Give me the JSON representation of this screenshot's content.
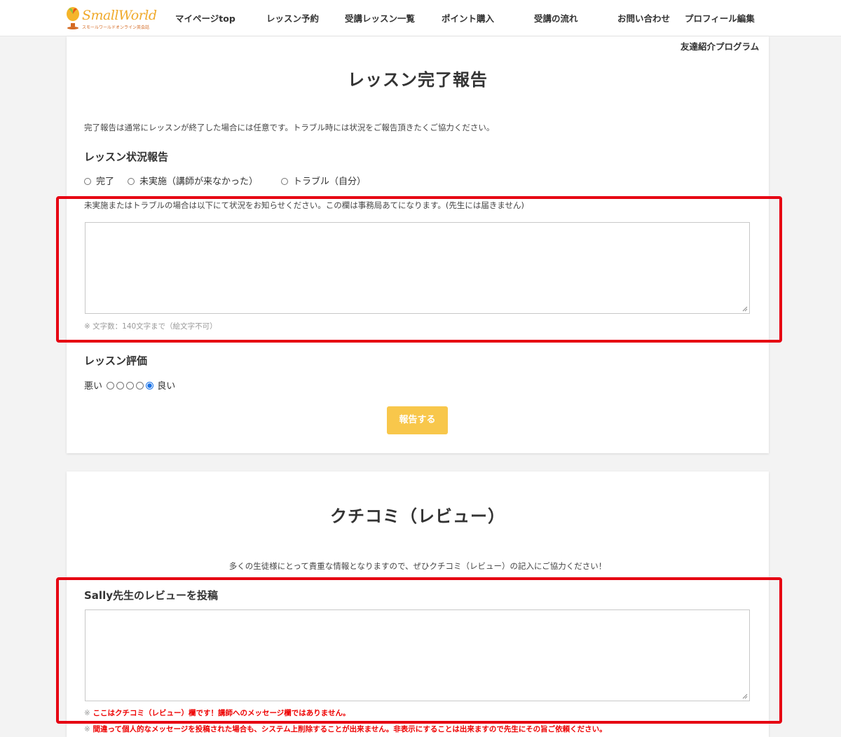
{
  "header": {
    "logo_text": "SmallWorld",
    "logo_sub": "スモールワールドオンライン英会話",
    "nav": [
      {
        "label": "マイページtop"
      },
      {
        "label": "レッスン予約"
      },
      {
        "label": "受講レッスン一覧"
      },
      {
        "label": "ポイント購入"
      },
      {
        "label": "受講の流れ"
      },
      {
        "label": "お問い合わせ"
      },
      {
        "label": "プロフィール編集"
      },
      {
        "label": "友達紹介プログラム"
      }
    ]
  },
  "report": {
    "title": "レッスン完了報告",
    "intro": "完了報告は通常にレッスンが終了した場合には任意です。トラブル時には状況をご報告頂きたくご協力ください。",
    "status_heading": "レッスン状況報告",
    "status_options": [
      {
        "label": "完了"
      },
      {
        "label": "未実施（講師が来なかった）"
      },
      {
        "label": "トラブル（自分）"
      }
    ],
    "note": "未実施またはトラブルの場合は以下にて状況をお知らせください。この欄は事務局あてになります。(先生には届きません)",
    "textarea_value": "",
    "hint": "※ 文字数：140文字まで（絵文字不可）",
    "rating_heading": "レッスン評価",
    "rating_bad": "悪い",
    "rating_good": "良い",
    "rating_count": 5,
    "rating_selected": 5,
    "submit_label": "報告する"
  },
  "review": {
    "title": "クチコミ（レビュー）",
    "intro": "多くの生徒様にとって貴重な情報となりますので、ぜひクチコミ（レビュー）の記入にご協力ください！",
    "post_heading": "Sally先生のレビューを投稿",
    "textarea_value": "",
    "warnings": [
      {
        "mark": "※",
        "text": "ここはクチコミ（レビュー）欄です！講師へのメッセージ欄ではありません。"
      },
      {
        "mark": "※",
        "text": "間違って個人的なメッセージを投稿された場合も、システム上削除することが出来ません。非表示にすることは出来ますので先生にその旨ご依頼ください。"
      }
    ]
  },
  "colors": {
    "accent_button": "#f8c74b",
    "highlight_box": "#e60012",
    "warning_text": "#e00000",
    "radio_selected": "#1a73e8"
  }
}
